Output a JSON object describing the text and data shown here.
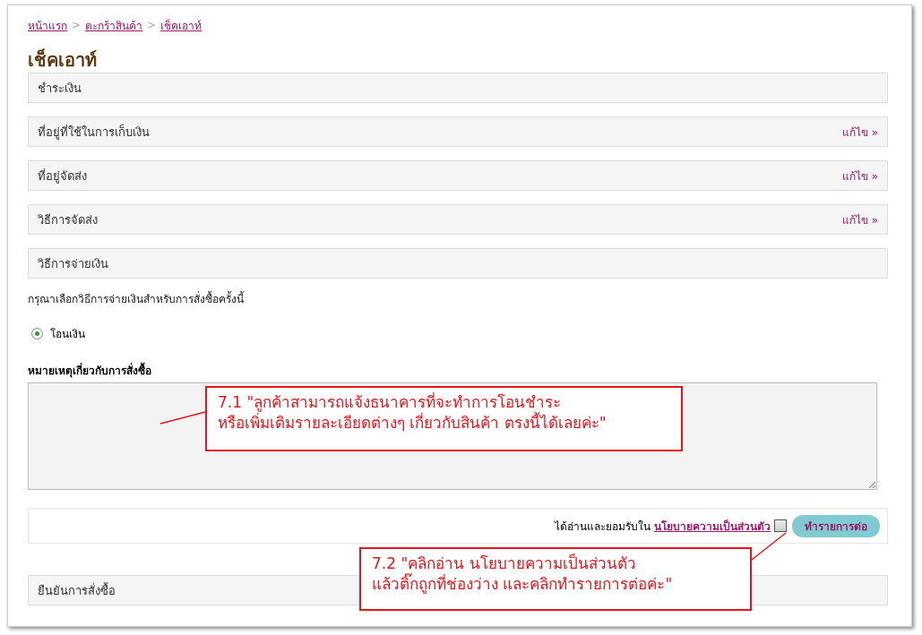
{
  "breadcrumb": [
    {
      "label": "หน้าแรก"
    },
    {
      "label": "ตะกร้าสินค้า"
    },
    {
      "label": "เช็คเอาท์"
    }
  ],
  "breadcrumb_separator": ">",
  "title": "เช็คเอาท์",
  "steps": [
    {
      "title": "ชำระเงิน"
    },
    {
      "title": "ที่อยู่ที่ใช้ในการเก็บเงิน",
      "action": "แก้ไข »"
    },
    {
      "title": "ที่อยู่จัดส่ง",
      "action": "แก้ไข »"
    },
    {
      "title": "วิธีการจัดส่ง",
      "action": "แก้ไข »"
    },
    {
      "title": "วิธีการจ่ายเงิน"
    }
  ],
  "payment_prompt": "กรุณาเลือกวิธีการจ่ายเงินสำหรับการสั่งซื้อครั้งนี้",
  "payment_options": [
    {
      "label": "โอนเงิน",
      "selected": true
    }
  ],
  "notes": {
    "label": "หมายเหตุเกี่ยวกับการสั่งซื้อ"
  },
  "agreement": {
    "text": "ได้อ่านและยอมรับใน",
    "link": "นโยบายความเป็นส่วนตัว",
    "checked": false,
    "button": "ทำรายการต่อ"
  },
  "final_step": {
    "title": "ยืนยันการสั่งซื้อ"
  },
  "annotations": [
    {
      "lines": [
        "7.1 \"ลูกค้าสามารถแจ้งธนาคารที่จะทำการโอนชำระ",
        "หรือเพิ่มเติมรายละเอียดต่างๆ เกี่ยวกับสินค้า ตรงนี้ได้เลยค่ะ\""
      ]
    },
    {
      "lines": [
        "7.2 \"คลิกอ่าน นโยบายความเป็นส่วนตัว",
        "แล้วติ๊กถูกที่ช่องว่าง และคลิกทำรายการต่อค่ะ\""
      ]
    }
  ]
}
